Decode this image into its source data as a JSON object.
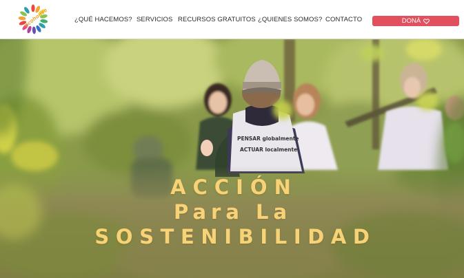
{
  "header": {
    "logo_text": "ecohouse",
    "nav": [
      {
        "label": "¿QUÉ HACEMOS?"
      },
      {
        "label": "SERVICIOS"
      },
      {
        "label": "RECURSOS GRATUITOS"
      },
      {
        "label": "¿QUIENES SOMOS?"
      },
      {
        "label": "CONTACTO"
      }
    ],
    "donate_label": "DONÁ",
    "donate_icon": "heart-icon",
    "donate_color": "#e1505f"
  },
  "hero": {
    "headline_line1": "ACCIÓN",
    "headline_line2": "Para La",
    "headline_line3": "SOSTENIBILIDAD",
    "headline_color": "#f7d277",
    "vest_line1": "PENSAR globalmente",
    "vest_line2": "ACTUAR localmente"
  }
}
